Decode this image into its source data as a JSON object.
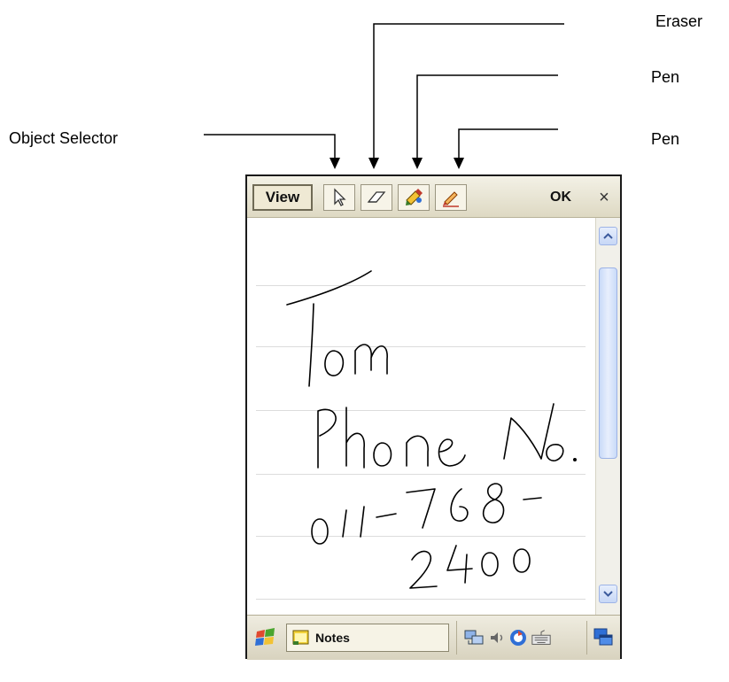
{
  "callouts": {
    "object_selector": "Object Selector",
    "eraser": "Eraser",
    "pen_top": "Pen",
    "pen_bottom": "Pen"
  },
  "toolbar": {
    "view_label": "View",
    "ok_label": "OK",
    "close_label": "×",
    "tools": [
      "object-selector-icon",
      "eraser-icon",
      "highlighter-pen-icon",
      "pen-icon"
    ]
  },
  "note": {
    "handwriting": [
      "Tom",
      "Phone No.",
      "011-768-",
      "2400"
    ]
  },
  "taskbar": {
    "app_label": "Notes",
    "tray_icons": [
      "network-icon",
      "volume-icon",
      "sync-icon",
      "keyboard-icon",
      "windows-switch-icon"
    ]
  },
  "colors": {
    "toolbar_bg": "#ded9c3",
    "scroll_accent": "#c9daf8",
    "ink": "#000000"
  }
}
